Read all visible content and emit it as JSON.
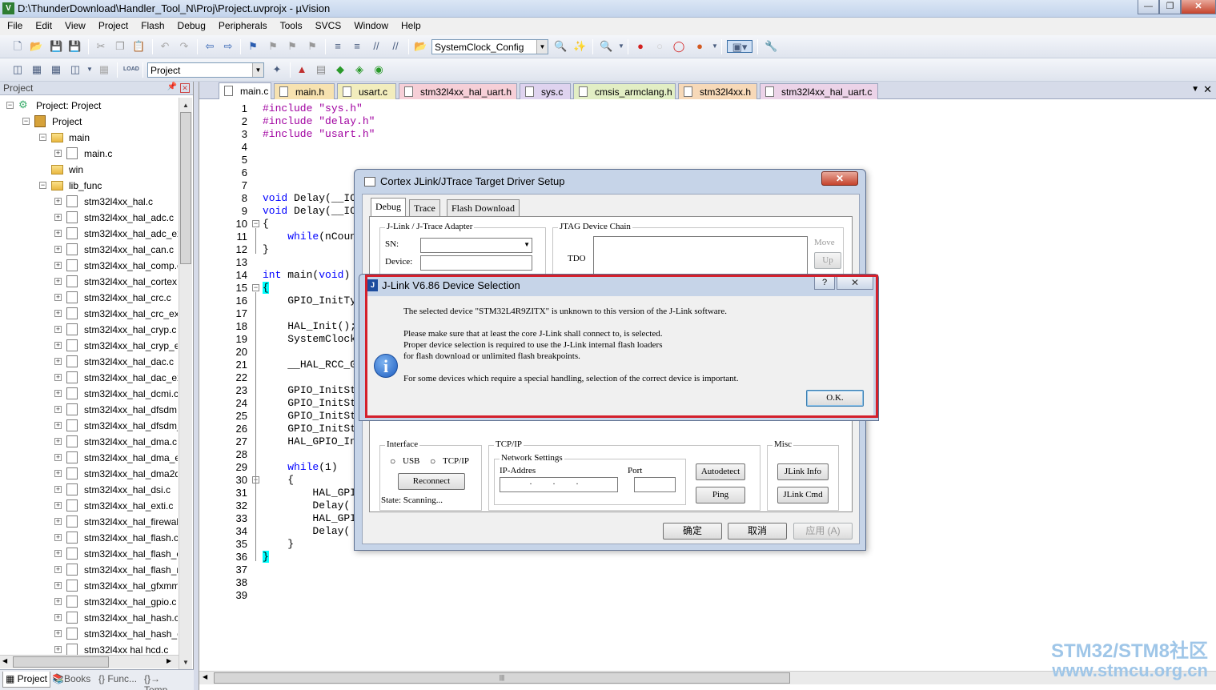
{
  "window": {
    "title": "D:\\ThunderDownload\\Handler_Tool_N\\Proj\\Project.uvprojx - µVision",
    "app_icon": "V",
    "controls": [
      "minimize-icon",
      "maximize-icon",
      "close-icon"
    ]
  },
  "menu": [
    "File",
    "Edit",
    "View",
    "Project",
    "Flash",
    "Debug",
    "Peripherals",
    "Tools",
    "SVCS",
    "Window",
    "Help"
  ],
  "toolbar1": {
    "function_combo": "SystemClock_Config"
  },
  "toolbar2": {
    "target_combo": "Project",
    "load_label": "LOAD"
  },
  "project_panel": {
    "title": "Project",
    "tree": [
      {
        "label": "Project: Project",
        "level": 0,
        "type": "root",
        "expander": "−"
      },
      {
        "label": "Project",
        "level": 1,
        "type": "proj",
        "expander": "−"
      },
      {
        "label": "main",
        "level": 2,
        "type": "folder",
        "expander": "−"
      },
      {
        "label": "main.c",
        "level": 3,
        "type": "file",
        "expander": "+"
      },
      {
        "label": "win",
        "level": 2,
        "type": "folder",
        "expander": ""
      },
      {
        "label": "lib_func",
        "level": 2,
        "type": "folder",
        "expander": "−"
      },
      {
        "label": "stm32l4xx_hal.c",
        "level": 3,
        "type": "file",
        "expander": "+"
      },
      {
        "label": "stm32l4xx_hal_adc.c",
        "level": 3,
        "type": "file",
        "expander": "+"
      },
      {
        "label": "stm32l4xx_hal_adc_ex.",
        "level": 3,
        "type": "file",
        "expander": "+"
      },
      {
        "label": "stm32l4xx_hal_can.c",
        "level": 3,
        "type": "file",
        "expander": "+"
      },
      {
        "label": "stm32l4xx_hal_comp.c",
        "level": 3,
        "type": "file",
        "expander": "+"
      },
      {
        "label": "stm32l4xx_hal_cortex.c",
        "level": 3,
        "type": "file",
        "expander": "+"
      },
      {
        "label": "stm32l4xx_hal_crc.c",
        "level": 3,
        "type": "file",
        "expander": "+"
      },
      {
        "label": "stm32l4xx_hal_crc_ex.c",
        "level": 3,
        "type": "file",
        "expander": "+"
      },
      {
        "label": "stm32l4xx_hal_cryp.c",
        "level": 3,
        "type": "file",
        "expander": "+"
      },
      {
        "label": "stm32l4xx_hal_cryp_ex",
        "level": 3,
        "type": "file",
        "expander": "+"
      },
      {
        "label": "stm32l4xx_hal_dac.c",
        "level": 3,
        "type": "file",
        "expander": "+"
      },
      {
        "label": "stm32l4xx_hal_dac_ex.",
        "level": 3,
        "type": "file",
        "expander": "+"
      },
      {
        "label": "stm32l4xx_hal_dcmi.c",
        "level": 3,
        "type": "file",
        "expander": "+"
      },
      {
        "label": "stm32l4xx_hal_dfsdm.",
        "level": 3,
        "type": "file",
        "expander": "+"
      },
      {
        "label": "stm32l4xx_hal_dfsdm_",
        "level": 3,
        "type": "file",
        "expander": "+"
      },
      {
        "label": "stm32l4xx_hal_dma.c",
        "level": 3,
        "type": "file",
        "expander": "+"
      },
      {
        "label": "stm32l4xx_hal_dma_ex",
        "level": 3,
        "type": "file",
        "expander": "+"
      },
      {
        "label": "stm32l4xx_hal_dma2d",
        "level": 3,
        "type": "file",
        "expander": "+"
      },
      {
        "label": "stm32l4xx_hal_dsi.c",
        "level": 3,
        "type": "file",
        "expander": "+"
      },
      {
        "label": "stm32l4xx_hal_exti.c",
        "level": 3,
        "type": "file",
        "expander": "+"
      },
      {
        "label": "stm32l4xx_hal_firewall",
        "level": 3,
        "type": "file",
        "expander": "+"
      },
      {
        "label": "stm32l4xx_hal_flash.c",
        "level": 3,
        "type": "file",
        "expander": "+"
      },
      {
        "label": "stm32l4xx_hal_flash_e",
        "level": 3,
        "type": "file",
        "expander": "+"
      },
      {
        "label": "stm32l4xx_hal_flash_ra",
        "level": 3,
        "type": "file",
        "expander": "+"
      },
      {
        "label": "stm32l4xx_hal_gfxmm",
        "level": 3,
        "type": "file",
        "expander": "+"
      },
      {
        "label": "stm32l4xx_hal_gpio.c",
        "level": 3,
        "type": "file",
        "expander": "+"
      },
      {
        "label": "stm32l4xx_hal_hash.c",
        "level": 3,
        "type": "file",
        "expander": "+"
      },
      {
        "label": "stm32l4xx_hal_hash_e",
        "level": 3,
        "type": "file",
        "expander": "+"
      },
      {
        "label": "stm32l4xx hal hcd.c",
        "level": 3,
        "type": "file",
        "expander": "+"
      }
    ],
    "bottom_tabs": [
      "Project",
      "Books",
      "{} Func...",
      "{}→ Temp..."
    ]
  },
  "file_tabs": [
    {
      "label": "main.c",
      "active": true,
      "color": "#ffffff"
    },
    {
      "label": "main.h",
      "active": false,
      "color": "#f7e2b0"
    },
    {
      "label": "usart.c",
      "active": false,
      "color": "#f2edbd"
    },
    {
      "label": "stm32l4xx_hal_uart.h",
      "active": false,
      "color": "#f6cfd7"
    },
    {
      "label": "sys.c",
      "active": false,
      "color": "#dfd3ef"
    },
    {
      "label": "cmsis_armclang.h",
      "active": false,
      "color": "#e2eec4"
    },
    {
      "label": "stm32l4xx.h",
      "active": false,
      "color": "#f7d9b8"
    },
    {
      "label": "stm32l4xx_hal_uart.c",
      "active": false,
      "color": "#ecd3e8"
    }
  ],
  "code_lines": [
    "#include \"sys.h\"",
    "#include \"delay.h\"",
    "#include \"usart.h\"",
    "",
    "",
    "",
    "",
    "void Delay(__IO",
    "void Delay(__IO",
    "{",
    "    while(nCoun",
    "}",
    "",
    "int main(void)",
    "{",
    "    GPIO_InitTy",
    "",
    "    HAL_Init();",
    "    SystemClock",
    "",
    "    __HAL_RCC_G",
    "",
    "    GPIO_InitSt",
    "    GPIO_InitSt",
    "    GPIO_InitSt",
    "    GPIO_InitSt",
    "    HAL_GPIO_In",
    "",
    "    while(1)",
    "    {",
    "        HAL_GPI",
    "        Delay(",
    "        HAL_GPI",
    "        Delay(",
    "    }",
    "}",
    "",
    "",
    ""
  ],
  "cortex_dialog": {
    "title": "Cortex JLink/JTrace Target Driver Setup",
    "tabs": [
      "Debug",
      "Trace",
      "Flash Download"
    ],
    "adapter_group": "J-Link / J-Trace Adapter",
    "sn_label": "SN:",
    "device_label": "Device:",
    "jtag_group": "JTAG Device Chain",
    "tdo_label": "TDO",
    "move_label": "Move",
    "up_button": "Up",
    "interface_group": "Interface",
    "usb_label": "USB",
    "tcpip_label": "TCP/IP",
    "reconnect_button": "Reconnect",
    "state_text": "State: Scanning...",
    "tcpip_group": "TCP/IP",
    "network_group": "Network Settings",
    "ip_label": "IP-Addres",
    "port_label": "Port",
    "ip_value": ". . .",
    "autodetect_button": "Autodetect",
    "ping_button": "Ping",
    "misc_group": "Misc",
    "jlink_info_button": "JLink Info",
    "jlink_cmd_button": "JLink Cmd",
    "ok_button": "确定",
    "cancel_button": "取消",
    "apply_button": "应用 (A)"
  },
  "jlink_dialog": {
    "title": "J-Link V6.86 Device Selection",
    "help": "?",
    "close": "✕",
    "message_lines": [
      "The selected device \"STM32L4R9ZITX\" is unknown to this version of the J-Link software.",
      "Please make sure that at least the core J-Link shall connect to, is selected.",
      "Proper device selection is required to use the J-Link internal flash loaders",
      "for flash download or unlimited flash breakpoints.",
      "For some devices which require a special handling, selection of the correct device is important."
    ],
    "ok_button": "O.K.",
    "highlight_color": "#d4202c"
  },
  "watermark": {
    "line1": "STM32/STM8社区",
    "line2": "www.stmcu.org.cn"
  }
}
